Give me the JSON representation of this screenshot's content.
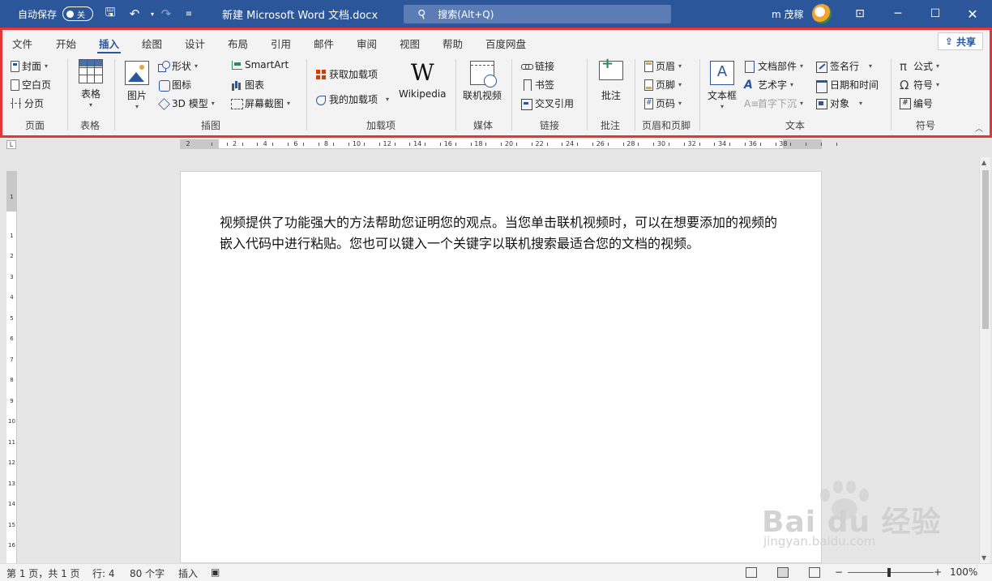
{
  "titlebar": {
    "autosave_label": "自动保存",
    "autosave_state": "关",
    "doc_title": "新建 Microsoft Word 文档.docx",
    "search_placeholder": "搜索(Alt+Q)",
    "user_name": "m 茂稼"
  },
  "tabs": [
    "文件",
    "开始",
    "插入",
    "绘图",
    "设计",
    "布局",
    "引用",
    "邮件",
    "审阅",
    "视图",
    "帮助",
    "百度网盘"
  ],
  "active_tab": "插入",
  "share_label": "共享",
  "ribbon": {
    "pages": {
      "group": "页面",
      "cover": "封面",
      "blank": "空白页",
      "break": "分页"
    },
    "tables": {
      "group": "表格",
      "table": "表格"
    },
    "illustrations": {
      "group": "插图",
      "picture": "图片",
      "shapes": "形状",
      "icons": "图标",
      "model3d": "3D 模型",
      "smartart": "SmartArt",
      "chart": "图表",
      "screenshot": "屏幕截图"
    },
    "addins": {
      "group": "加载项",
      "get": "获取加载项",
      "mine": "我的加载项",
      "wiki": "Wikipedia"
    },
    "media": {
      "group": "媒体",
      "video": "联机视频"
    },
    "links": {
      "group": "链接",
      "link": "链接",
      "bookmark": "书签",
      "xref": "交叉引用"
    },
    "comments": {
      "group": "批注",
      "comment": "批注"
    },
    "header_footer": {
      "group": "页眉和页脚",
      "header": "页眉",
      "footer": "页脚",
      "page_number": "页码"
    },
    "text": {
      "group": "文本",
      "textbox": "文本框",
      "quickparts": "文档部件",
      "wordart": "艺术字",
      "dropcap": "首字下沉",
      "signature": "签名行",
      "datetime": "日期和时间",
      "object": "对象"
    },
    "symbols": {
      "group": "符号",
      "equation": "公式",
      "symbol": "符号",
      "number": "编号"
    }
  },
  "ruler_numbers": [
    "2",
    "2",
    "4",
    "6",
    "8",
    "10",
    "12",
    "14",
    "16",
    "18",
    "20",
    "22",
    "24",
    "26",
    "28",
    "30",
    "32",
    "34",
    "36",
    "38"
  ],
  "vruler_numbers": [
    "1",
    "1",
    "2",
    "3",
    "4",
    "5",
    "6",
    "7",
    "8",
    "9",
    "10",
    "11",
    "12",
    "13",
    "14",
    "15",
    "16",
    "17"
  ],
  "document": {
    "body": "视频提供了功能强大的方法帮助您证明您的观点。当您单击联机视频时，可以在想要添加的视频的嵌入代码中进行粘贴。您也可以键入一个关键字以联机搜索最适合您的文档的视频。"
  },
  "statusbar": {
    "page": "第 1 页，共 1 页",
    "line": "行: 4",
    "words": "80 个字",
    "mode": "插入",
    "zoom": "100%"
  },
  "watermark": {
    "brand": "Bai du 经验",
    "url": "jingyan.baidu.com"
  },
  "colors": {
    "titlebar": "#2b579a",
    "highlight_border": "#e33636"
  }
}
